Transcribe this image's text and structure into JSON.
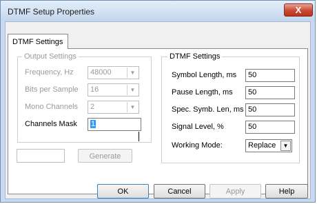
{
  "window": {
    "title": "DTMF Setup Properties",
    "close_label": "X"
  },
  "tabs": [
    {
      "label": "DTMF Settings"
    }
  ],
  "output_settings": {
    "legend": "Output Settings",
    "frequency": {
      "label": "Frequency, Hz",
      "value": "48000"
    },
    "bits_per_sample": {
      "label": "Bits per Sample",
      "value": "16"
    },
    "mono_channels": {
      "label": "Mono Channels",
      "value": "2"
    },
    "channels_mask": {
      "label": "Channels Mask",
      "value": "1"
    }
  },
  "dtmf_settings": {
    "legend": "DTMF Settings",
    "symbol_length": {
      "label": "Symbol Length, ms",
      "value": "50"
    },
    "pause_length": {
      "label": "Pause Length, ms",
      "value": "50"
    },
    "spec_symb_len": {
      "label": "Spec. Symb. Len, ms",
      "value": "50"
    },
    "signal_level": {
      "label": "Signal Level, %",
      "value": "50"
    },
    "working_mode": {
      "label": "Working Mode:",
      "value": "Replace"
    }
  },
  "generate": {
    "input_value": "",
    "button_label": "Generate"
  },
  "footer": {
    "ok": "OK",
    "cancel": "Cancel",
    "apply": "Apply",
    "help": "Help"
  }
}
